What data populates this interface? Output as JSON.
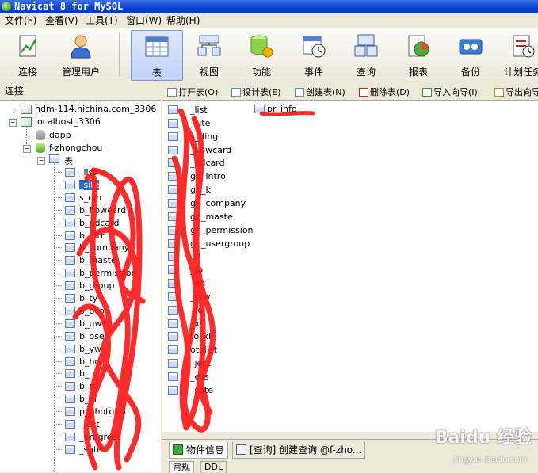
{
  "window": {
    "title": "Navicat 8 for MySQL"
  },
  "menubar": {
    "items": [
      "文件(F)",
      "查看(V)",
      "工具(T)",
      "窗口(W)",
      "帮助(H)"
    ]
  },
  "toolbar": {
    "items": [
      {
        "label": "连接",
        "icon": "connect-icon"
      },
      {
        "label": "管理用户",
        "icon": "user-icon"
      },
      {
        "label": "表",
        "icon": "table-icon"
      },
      {
        "label": "视图",
        "icon": "view-icon"
      },
      {
        "label": "功能",
        "icon": "function-icon"
      },
      {
        "label": "事件",
        "icon": "event-icon"
      },
      {
        "label": "查询",
        "icon": "query-icon"
      },
      {
        "label": "报表",
        "icon": "report-icon"
      },
      {
        "label": "备份",
        "icon": "backup-icon"
      },
      {
        "label": "计划任务",
        "icon": "schedule-icon"
      }
    ],
    "active": "表"
  },
  "left_panel": {
    "header": "连接",
    "connections": [
      {
        "label": "hdm-114.hichina.com_3306"
      },
      {
        "label": "localhost_3306"
      }
    ],
    "databases": [
      {
        "label": "dapp"
      },
      {
        "label": "f-zhongchou"
      }
    ],
    "table_group": "表",
    "tables": [
      "_list",
      "_site",
      "s_din",
      "b_flowcard",
      "b_ndcard",
      "b_intr",
      "b_company",
      "b_maste",
      "b_permission",
      "b_group",
      "b_ty",
      "b_oco",
      "b_uwen",
      "b_ose",
      "b_yw",
      "b_ho",
      "b_",
      "b_ro",
      "b_xl",
      "p_photolist",
      "_ject",
      "_progress",
      "_sate"
    ]
  },
  "object_toolbar": {
    "buttons": [
      "打开表(O)",
      "设计表(E)",
      "创建表(N)",
      "删除表(D)",
      "导入向导(I)",
      "导出向导"
    ]
  },
  "object_list": {
    "items": [
      "_list",
      "_site",
      "s_ding",
      "_flowcard",
      "_ndcard",
      "gn_intro",
      "gn_k",
      "gn_company",
      "gn_maste",
      "gn_permission",
      "gn_usergroup",
      "_ti",
      "_fo",
      "_en",
      "_ryw",
      "_fo",
      "_xl",
      "to_xl",
      "otolist",
      "_ject",
      "_ess",
      "_sate"
    ],
    "col2_item": "pr_info"
  },
  "bottom_tabs": {
    "tabs": [
      "物件信息",
      "[查询] 创建查询 @f-zho..."
    ],
    "sub_tabs": [
      "常规",
      "DDL"
    ]
  },
  "watermark": {
    "brand": "Baidu 经验",
    "url": "jingyan.baidu.com"
  },
  "colors": {
    "titlebar": "#0a3fcc",
    "scribble": "#ff1a1a",
    "selection": "#316ac5"
  }
}
